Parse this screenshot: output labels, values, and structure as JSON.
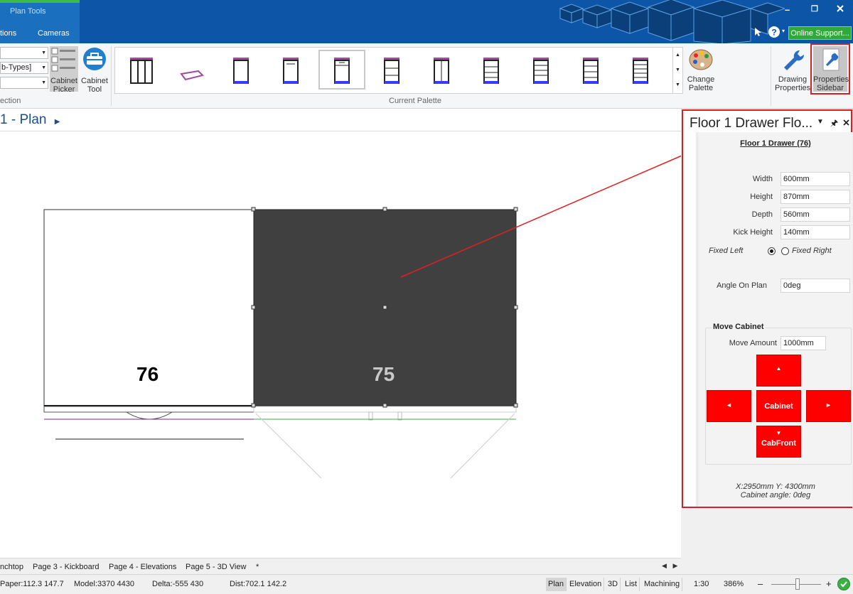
{
  "ribbon_tabs": {
    "plan_tools": "Plan Tools",
    "options": "tions",
    "cameras": "Cameras",
    "online_support": "Online Support...",
    "window_min": "–",
    "window_restore": "❐"
  },
  "ribbon": {
    "combo_top": "",
    "combo_mid": "b-Types]",
    "combo_bottom": "",
    "selection_group_label": "ection",
    "cabinet_picker_label": "Cabinet Picker",
    "cabinet_tool_label": "Cabinet Tool",
    "palette_group_label": "Current Palette",
    "change_palette_label": "Change Palette",
    "drawing_properties_label": "Drawing Properties",
    "properties_sidebar_label": "Properties Sidebar",
    "palette_items": [
      "tall-cabinet",
      "kickboard",
      "base-cabinet-1",
      "base-cabinet-2",
      "base-cabinet-selected",
      "drawer-cabinet-2",
      "door-cabinet",
      "drawer-cabinet-3",
      "drawer-cabinet-4",
      "drawer-cabinet-5",
      "drawer-cabinet-6"
    ]
  },
  "document": {
    "title": "1 - Plan",
    "cabinet_left_number": "76",
    "cabinet_right_number": "75"
  },
  "sidebar": {
    "title": "Floor 1 Drawer Flo...",
    "header": "Floor 1 Drawer (76)",
    "width_label": "Width",
    "width_value": "600mm",
    "height_label": "Height",
    "height_value": "870mm",
    "depth_label": "Depth",
    "depth_value": "560mm",
    "kick_label": "Kick Height",
    "kick_value": "140mm",
    "fixed_left": "Fixed Left",
    "fixed_right": "Fixed Right",
    "fixed_selected": "left",
    "angle_label": "Angle On Plan",
    "angle_value": "0deg",
    "move_title": "Move Cabinet",
    "move_amount_label": "Move Amount",
    "move_amount_value": "1000mm",
    "btn_up": "▲",
    "btn_left": "◄",
    "btn_cabinet": "Cabinet",
    "btn_right": "►",
    "btn_down_arrow": "▼",
    "btn_cabfront": "CabFront",
    "coords_line1": "X:2950mm Y: 4300mm",
    "coords_line2": "Cabinet angle: 0deg"
  },
  "page_tabs": [
    "nchtop",
    "Page 3 - Kickboard",
    "Page 4 - Elevations",
    "Page 5 - 3D View",
    "*"
  ],
  "status": {
    "paper": "Paper:112.3 147.7",
    "model": "Model:3370 4430",
    "delta": "Delta:-555 430",
    "dist": "Dist:702.1 142.2",
    "views": [
      "Plan",
      "Elevation",
      "3D",
      "List",
      "Machining"
    ],
    "active_view": "Plan",
    "scale": "1:30",
    "zoom": "386%",
    "zoom_minus": "–",
    "zoom_plus": "+"
  },
  "colors": {
    "ribbon_blue": "#0d55a6",
    "accent_red": "#d42222",
    "button_red": "#ff0000",
    "cabinet_dark": "#404040",
    "palette_purple": "#a349a4",
    "palette_blue": "#3a3aff"
  }
}
